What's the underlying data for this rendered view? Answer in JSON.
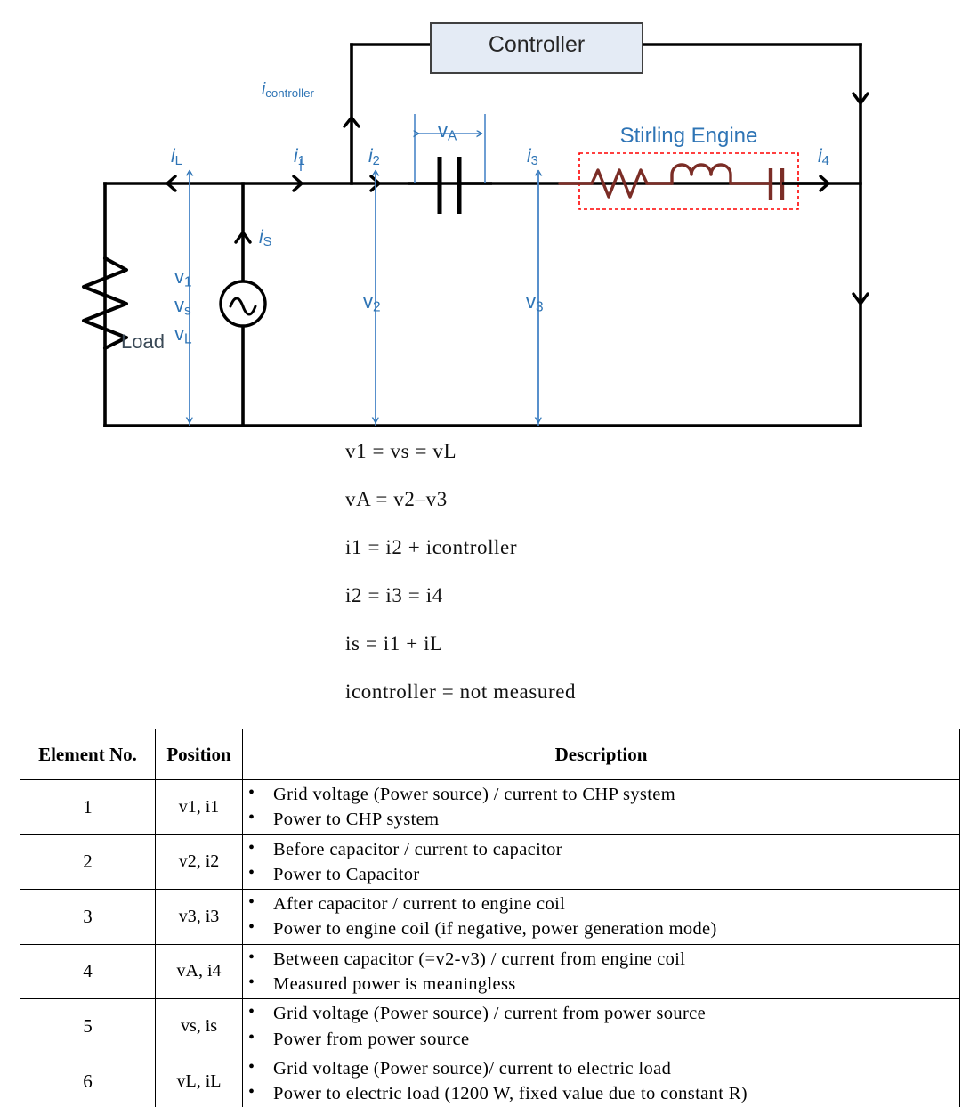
{
  "diagram": {
    "controller_label": "Controller",
    "stirling_label": "Stirling Engine",
    "load_label": "Load",
    "currents": {
      "i_controller": "i",
      "i_controller_sub": "controller",
      "iL": "i",
      "iL_sub": "L",
      "i1": "i",
      "i1_sub": "1",
      "i2": "i",
      "i2_sub": "2",
      "i3": "i",
      "i3_sub": "3",
      "i4": "i",
      "i4_sub": "4",
      "is": "i",
      "is_sub": "S"
    },
    "voltages": {
      "vA": "v",
      "vA_sub": "A",
      "v1": "v",
      "v1_sub": "1",
      "vs": "v",
      "vs_sub": "s",
      "vL": "v",
      "vL_sub": "L",
      "v2": "v",
      "v2_sub": "2",
      "v3": "v",
      "v3_sub": "3"
    },
    "colors": {
      "wire": "#000000",
      "annotation": "#2E74B5",
      "controller_fill": "#E4EBF5",
      "engine_component": "#7B2D26",
      "engine_box_border": "#FF0000",
      "label_dark": "#3b4a57"
    }
  },
  "equations": [
    {
      "text": "v1  =  vs  =  vL"
    },
    {
      "text": "vA  =  v2–v3"
    },
    {
      "text": "i1  =  i2  +  icontroller"
    },
    {
      "text": "i2  =  i3  =  i4"
    },
    {
      "text": "is  =  i1  +  iL"
    },
    {
      "text": "icontroller  =  not  measured"
    }
  ],
  "table": {
    "headers": [
      "Element No.",
      "Position",
      "Description"
    ],
    "rows": [
      {
        "no": "1",
        "position": "v1, i1",
        "description": [
          "Grid  voltage  (Power  source)  /  current  to  CHP  system",
          "Power  to  CHP  system"
        ]
      },
      {
        "no": "2",
        "position": "v2, i2",
        "description": [
          "Before  capacitor  /  current  to  capacitor",
          "Power  to  Capacitor"
        ]
      },
      {
        "no": "3",
        "position": "v3, i3",
        "description": [
          "After  capacitor  /  current  to  engine  coil",
          "Power  to  engine  coil  (if  negative,  power  generation  mode)"
        ]
      },
      {
        "no": "4",
        "position": "vA, i4",
        "description": [
          "Between  capacitor  (=v2-v3)  /  current  from  engine  coil",
          "Measured  power  is  meaningless"
        ]
      },
      {
        "no": "5",
        "position": "vs, is",
        "description": [
          "Grid  voltage  (Power  source)  /  current  from  power  source",
          "Power  from  power  source"
        ]
      },
      {
        "no": "6",
        "position": "vL, iL",
        "description": [
          "Grid  voltage  (Power  source)/  current  to  electric  load",
          "Power  to  electric  load  (1200  W,  fixed  value  due  to  constant  R)"
        ]
      }
    ]
  }
}
